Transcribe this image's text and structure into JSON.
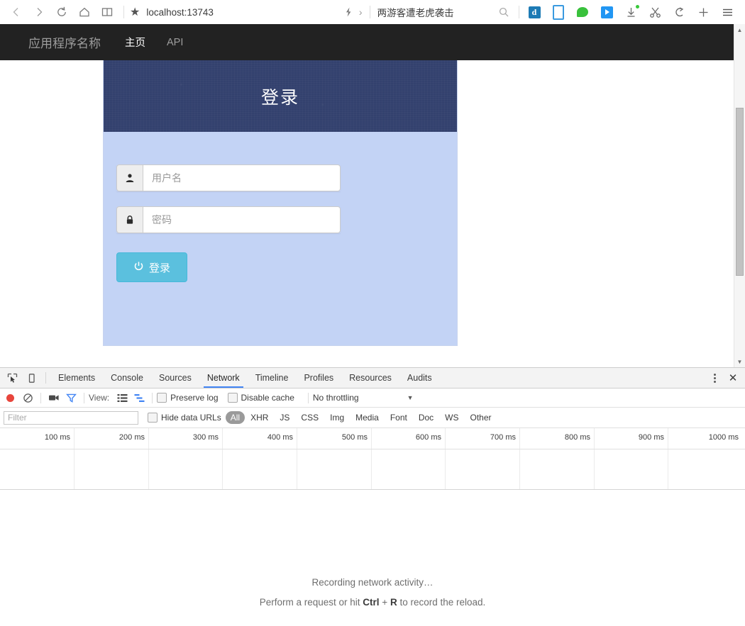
{
  "browser": {
    "nav": {
      "back": "back-arrow",
      "forward": "forward-arrow",
      "reload": "reload",
      "home": "home",
      "reading_list": "reading-list"
    },
    "address": {
      "bookmark_star": "★",
      "url": "localhost:13743"
    },
    "quick_access": {
      "bolt": "bolt-icon",
      "chevron": "›",
      "news_headline": "两游客遭老虎袭击",
      "search": "search-icon"
    },
    "extensions": [
      {
        "name": "dict-extension",
        "glyph": "d"
      },
      {
        "name": "mobile-view",
        "glyph": ""
      },
      {
        "name": "wechat",
        "glyph": ""
      },
      {
        "name": "video-player",
        "glyph": ""
      },
      {
        "name": "downloads",
        "glyph": ""
      },
      {
        "name": "screenshot-snip",
        "glyph": ""
      },
      {
        "name": "undo-close-tab",
        "glyph": ""
      },
      {
        "name": "new-tab",
        "glyph": "+"
      },
      {
        "name": "main-menu",
        "glyph": "≡"
      }
    ]
  },
  "page": {
    "navbar": {
      "brand": "应用程序名称",
      "links": [
        {
          "label": "主页",
          "active": true
        },
        {
          "label": "API",
          "active": false
        }
      ]
    },
    "login_panel": {
      "title": "登录",
      "username": {
        "icon": "user-icon",
        "placeholder": "用户名",
        "value": ""
      },
      "password": {
        "icon": "lock-icon",
        "placeholder": "密码",
        "value": ""
      },
      "submit": {
        "icon": "power-icon",
        "label": "登录"
      }
    }
  },
  "devtools": {
    "left_icons": [
      {
        "name": "inspect-element-icon"
      },
      {
        "name": "device-toolbar-icon"
      }
    ],
    "tabs": [
      {
        "label": "Elements",
        "active": false
      },
      {
        "label": "Console",
        "active": false
      },
      {
        "label": "Sources",
        "active": false
      },
      {
        "label": "Network",
        "active": true
      },
      {
        "label": "Timeline",
        "active": false
      },
      {
        "label": "Profiles",
        "active": false
      },
      {
        "label": "Resources",
        "active": false
      },
      {
        "label": "Audits",
        "active": false
      }
    ],
    "window_controls": {
      "more": "more-options-icon",
      "close": "✕"
    },
    "network_toolbar": {
      "record": "record-button",
      "clear": "clear-button",
      "capture_screenshots": "camera-icon",
      "filter": "filter-icon",
      "view_label": "View:",
      "view_list": "list-view-icon",
      "view_waterfall": "waterfall-view-icon",
      "preserve_log": {
        "label": "Preserve log",
        "checked": false
      },
      "disable_cache": {
        "label": "Disable cache",
        "checked": false
      },
      "throttling": {
        "value": "No throttling",
        "caret": "▼"
      }
    },
    "filter_bar": {
      "filter_placeholder": "Filter",
      "filter_value": "",
      "hide_data_urls": {
        "label": "Hide data URLs",
        "checked": false
      },
      "types": [
        {
          "label": "All",
          "selected": true
        },
        {
          "label": "XHR",
          "selected": false
        },
        {
          "label": "JS",
          "selected": false
        },
        {
          "label": "CSS",
          "selected": false
        },
        {
          "label": "Img",
          "selected": false
        },
        {
          "label": "Media",
          "selected": false
        },
        {
          "label": "Font",
          "selected": false
        },
        {
          "label": "Doc",
          "selected": false
        },
        {
          "label": "WS",
          "selected": false
        },
        {
          "label": "Other",
          "selected": false
        }
      ]
    },
    "timeline_ruler": {
      "ticks": [
        "100 ms",
        "200 ms",
        "300 ms",
        "400 ms",
        "500 ms",
        "600 ms",
        "700 ms",
        "800 ms",
        "900 ms",
        "1000 ms"
      ]
    },
    "empty_state": {
      "line1": "Recording network activity…",
      "line2_before": "Perform a request or hit ",
      "line2_key1": "Ctrl",
      "line2_plus": " + ",
      "line2_key2": "R",
      "line2_after": " to record the reload."
    }
  },
  "colors": {
    "navbar_bg": "#222222",
    "panel_header_bg": "#33416e",
    "panel_body_bg": "#c3d3f5",
    "button_bg": "#5bc0de",
    "devtools_accent": "#4285f4",
    "record_red": "#e8453c"
  }
}
